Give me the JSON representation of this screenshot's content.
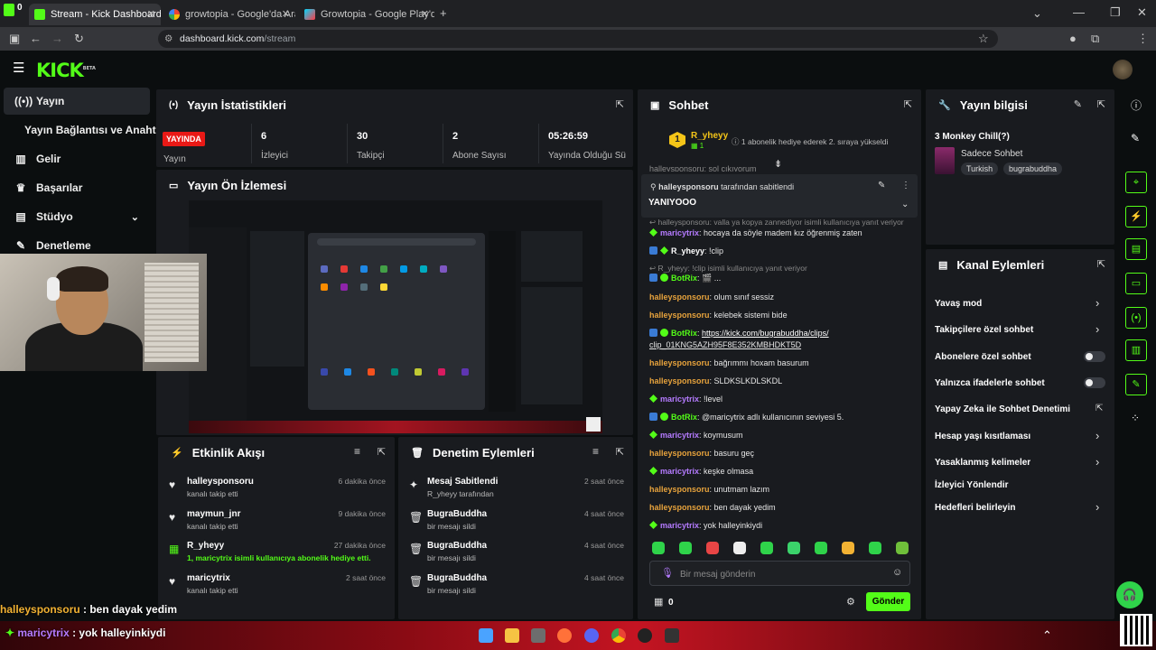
{
  "browser": {
    "tabs": [
      {
        "label": "Stream - Kick Dashboard",
        "active": true
      },
      {
        "label": "growtopia - Google'da Ara"
      },
      {
        "label": "Growtopia - Google Play'de Uy:"
      }
    ],
    "url_host": "dashboard.kick.com",
    "url_path": "/stream",
    "corner_count": "0"
  },
  "brand": {
    "logo": "KICK",
    "beta": "BETA",
    "accent": "#53fc18"
  },
  "sidebar": {
    "items": [
      {
        "label": "Yayın",
        "icon": "broadcast-icon",
        "active": true
      },
      {
        "label": "Yayın Bağlantısı ve Anahtarı",
        "icon": ""
      },
      {
        "label": "Gelir",
        "icon": "chart-icon"
      },
      {
        "label": "Başarılar",
        "icon": "trophy-icon"
      },
      {
        "label": "Stüdyo",
        "icon": "studio-icon"
      },
      {
        "label": "Denetleme",
        "icon": "wrench-icon"
      }
    ]
  },
  "stats": {
    "title": "Yayın İstatistikleri",
    "live_badge": "YAYINDA",
    "live_label": "Yayın",
    "items": [
      {
        "value": "6",
        "label": "İzleyici"
      },
      {
        "value": "30",
        "label": "Takipçi"
      },
      {
        "value": "2",
        "label": "Abone Sayısı"
      },
      {
        "value": "05:26:59",
        "label": "Yayında Olduğu Sü"
      }
    ]
  },
  "preview": {
    "title": "Yayın Ön İzlemesi"
  },
  "activity": {
    "title": "Etkinlik Akışı",
    "items": [
      {
        "name": "halleysponsoru",
        "sub": "kanalı takip etti",
        "time": "6 dakika önce",
        "icon": "heart-icon"
      },
      {
        "name": "maymun_jnr",
        "sub": "kanalı takip etti",
        "time": "9 dakika önce",
        "icon": "heart-icon"
      },
      {
        "name": "R_yheyy",
        "sub": "1, maricytrix isimli kullanıcıya abonelik hediye etti.",
        "time": "27 dakika önce",
        "icon": "gift-icon"
      },
      {
        "name": "maricytrix",
        "sub": "kanalı takip etti",
        "time": "2 saat önce",
        "icon": "heart-icon"
      }
    ]
  },
  "moderation": {
    "title": "Denetim Eylemleri",
    "items": [
      {
        "name": "Mesaj Sabitlendi",
        "sub": "R_yheyy tarafından",
        "time": "2 saat önce",
        "icon": "pin-icon"
      },
      {
        "name": "BugraBuddha",
        "sub": "bir mesajı sildi",
        "time": "4 saat önce",
        "icon": "trash-icon"
      },
      {
        "name": "BugraBuddha",
        "sub": "bir mesajı sildi",
        "time": "4 saat önce",
        "icon": "trash-icon"
      },
      {
        "name": "BugraBuddha",
        "sub": "bir mesajı sildi",
        "time": "4 saat önce",
        "icon": "trash-icon"
      }
    ]
  },
  "chat": {
    "title": "Sohbet",
    "top_gifter": {
      "rank": "1",
      "name": "R_yheyy",
      "count": "1"
    },
    "gift_note": "1 abonelik hediye ederek 2. sıraya yükseldi",
    "partial_line": "halleysponsoru: sol çıkıyorum",
    "pinned": {
      "by": "halleysponsoru",
      "by_suffix": " tarafından sabitlendi",
      "text": "YANIYOOO"
    },
    "messages": [
      {
        "reply": "valla ya kopya zannediyor isimli kullanıcıya yanıt veriyor"
      },
      {
        "user": "maricytrix",
        "color": "#b57bff",
        "text": "hocaya da söyle madem kız öğrenmiş zaten",
        "badge": "sub"
      },
      {
        "user": "R_yheyy",
        "color": "#ffffff",
        "text": "!clip",
        "badge": "mod"
      },
      {
        "reply": "R_yheyy: !clip isimli kullanıcıya yanıt veriyor"
      },
      {
        "user": "BotRix",
        "color": "#53fc18",
        "text": "🎬 ...",
        "badge": "bot"
      },
      {
        "user": "halleysponsoru",
        "color": "#e6a23c",
        "text": "olum sınıf sessiz"
      },
      {
        "user": "halleysponsoru",
        "color": "#e6a23c",
        "text": "kelebek sistemi bide"
      },
      {
        "user": "BotRix",
        "color": "#53fc18",
        "text": "https://kick.com/bugrabuddha/clips/",
        "text2": "clip_01KNG5AZH95F8E352KMBHDKT5D",
        "badge": "bot",
        "link": true
      },
      {
        "user": "halleysponsoru",
        "color": "#e6a23c",
        "text": "bağrımmı hoxam basurum"
      },
      {
        "user": "halleysponsoru",
        "color": "#e6a23c",
        "text": "SLDKSLKDLSKDL"
      },
      {
        "user": "maricytrix",
        "color": "#b57bff",
        "text": "!level",
        "badge": "sub"
      },
      {
        "user": "BotRix",
        "color": "#53fc18",
        "text": "@maricytrix adlı kullanıcının seviyesi 5.",
        "badge": "bot"
      },
      {
        "user": "maricytrix",
        "color": "#b57bff",
        "text": "koymusum",
        "badge": "sub"
      },
      {
        "user": "halleysponsoru",
        "color": "#e6a23c",
        "text": "basuru geç"
      },
      {
        "user": "maricytrix",
        "color": "#b57bff",
        "text": "keşke olmasa",
        "badge": "sub"
      },
      {
        "user": "halleysponsoru",
        "color": "#e6a23c",
        "text": "unutmam lazım"
      },
      {
        "user": "halleysponsoru",
        "color": "#e6a23c",
        "text": "ben dayak yedim"
      },
      {
        "user": "maricytrix",
        "color": "#b57bff",
        "text": "yok halleyinkiydi",
        "badge": "sub"
      }
    ],
    "input_placeholder": "Bir mesaj gönderin",
    "points": "0",
    "send_label": "Gönder"
  },
  "stream_info": {
    "title": "Yayın bilgisi",
    "stream_title": "3 Monkey Chill(?)",
    "chat_mode": "Sadece Sohbet",
    "tags": [
      "Turkish",
      "bugrabuddha"
    ]
  },
  "channel_actions": {
    "title": "Kanal Eylemleri",
    "items": [
      {
        "label": "Yavaş mod",
        "control": "chevron"
      },
      {
        "label": "Takipçilere özel sohbet",
        "control": "chevron"
      },
      {
        "label": "Abonelere özel sohbet",
        "control": "toggle",
        "on": false
      },
      {
        "label": "Yalnızca ifadelerle sohbet",
        "control": "toggle",
        "on": false
      },
      {
        "label": "Yapay Zeka ile Sohbet Denetimi",
        "control": "external"
      },
      {
        "label": "Hesap yaşı kısıtlaması",
        "control": "chevron"
      },
      {
        "label": "Yasaklanmış kelimeler",
        "control": "chevron"
      },
      {
        "label": "İzleyici Yönlendir",
        "control": "none"
      },
      {
        "label": "Hedefleri belirleyin",
        "control": "chevron"
      }
    ]
  },
  "overlay": {
    "line1_user": "halleysponsoru",
    "line1_text": " : ben dayak yedim",
    "line2_user": "maricytrix",
    "line2_text": " : yok halleyinkiydi"
  }
}
